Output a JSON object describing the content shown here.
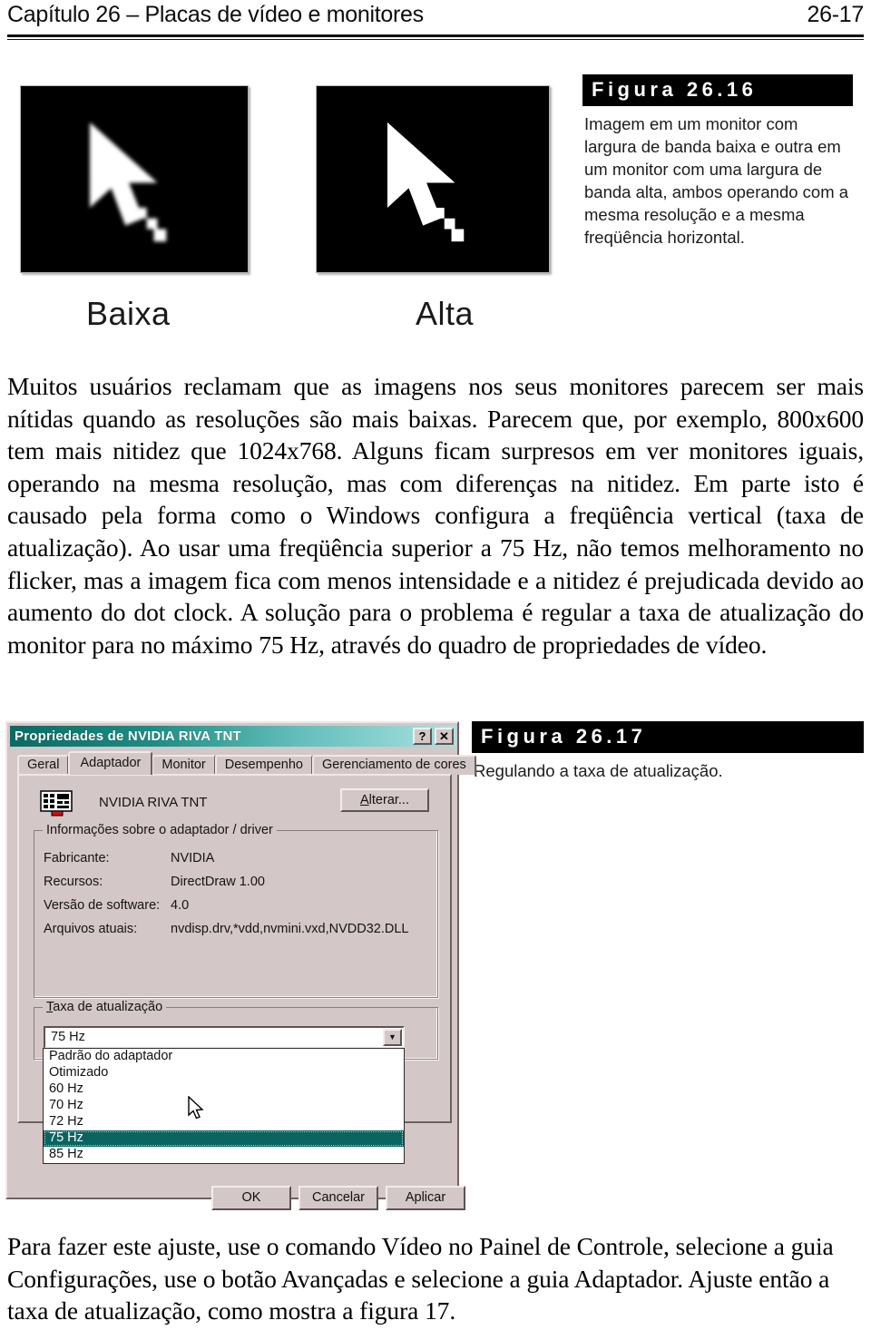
{
  "header": {
    "chapter": "Capítulo 26 – Placas de vídeo e monitores",
    "page_number": "26-17"
  },
  "figure_26_16": {
    "caption_title": "Figura 26.16",
    "caption_body": "Imagem em um monitor com largura de banda baixa e outra em um monitor com uma largura de banda alta, ambos operando com a mesma resolução e a mesma freqüência horizontal.",
    "label_low": "Baixa",
    "label_high": "Alta"
  },
  "paragraphs": {
    "p1": "Muitos usuários reclamam que as imagens nos seus monitores parecem ser mais nítidas quando as resoluções são mais baixas. Parecem que, por exemplo, 800x600 tem mais nitidez que 1024x768. Alguns ficam surpresos em ver monitores iguais, operando na mesma resolução, mas com diferenças na nitidez. Em parte isto é causado pela forma como o Windows configura a freqüência vertical (taxa de atualização). Ao usar uma freqüência superior a 75 Hz, não temos melhoramento no flicker, mas a imagem fica com menos intensidade e a nitidez é prejudicada devido ao aumento do dot clock. A solução para o problema é regular a taxa de atualização do monitor para no máximo 75 Hz, através do quadro de propriedades de vídeo.",
    "p2": "Para fazer este ajuste, use o comando Vídeo no Painel de Controle, selecione a guia Configurações, use o botão Avançadas e selecione a guia Adaptador. Ajuste então a taxa de atualização, como mostra a figura 17."
  },
  "figure_26_17": {
    "caption_title": "Figura 26.17",
    "caption_body": "Regulando a taxa de atualização."
  },
  "dialog": {
    "title": "Propriedades de NVIDIA RIVA TNT",
    "help_button": "?",
    "close_button": "✕",
    "tabs": [
      {
        "label": "Geral",
        "active": false
      },
      {
        "label": "Adaptador",
        "active": true
      },
      {
        "label": "Monitor",
        "active": false
      },
      {
        "label": "Desempenho",
        "active": false
      },
      {
        "label": "Gerenciamento de cores",
        "active": false
      }
    ],
    "adapter_name": "NVIDIA RIVA TNT",
    "change_button": "Alterar...",
    "info_group_legend": "Informações sobre o adaptador / driver",
    "info_rows": [
      {
        "label": "Fabricante:",
        "value": "NVIDIA"
      },
      {
        "label": "Recursos:",
        "value": "DirectDraw 1.00"
      },
      {
        "label": "Versão de software:",
        "value": "4.0"
      },
      {
        "label": "Arquivos atuais:",
        "value": "nvdisp.drv,*vdd,nvmini.vxd,NVDD32.DLL"
      }
    ],
    "rate_group_legend": "Taxa de atualização",
    "rate_selected": "75 Hz",
    "rate_options": [
      {
        "label": "Padrão do adaptador",
        "selected": false
      },
      {
        "label": "Otimizado",
        "selected": false
      },
      {
        "label": "60 Hz",
        "selected": false
      },
      {
        "label": "70 Hz",
        "selected": false
      },
      {
        "label": "72 Hz",
        "selected": false
      },
      {
        "label": "75 Hz",
        "selected": true
      },
      {
        "label": "85 Hz",
        "selected": false
      }
    ],
    "buttons": {
      "ok": "OK",
      "cancel": "Cancelar",
      "apply": "Aplicar"
    },
    "colors": {
      "face": "#d4c7c7",
      "titlebar_start": "#0b6a63",
      "titlebar_end": "#a8e2e0",
      "selection": "#0a6460"
    }
  }
}
